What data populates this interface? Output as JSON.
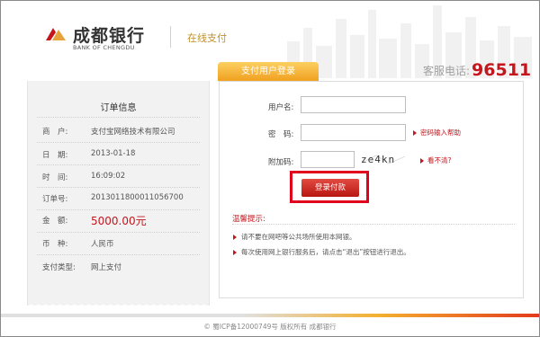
{
  "header": {
    "bank_name_cn": "成都银行",
    "bank_name_en": "BANK OF CHENGDU",
    "section": "在线支付",
    "hotline_label": "客服电话:",
    "hotline_number": "96511"
  },
  "login_tab": "支付用户登录",
  "order": {
    "title": "订单信息",
    "rows": [
      {
        "label": "商　户:",
        "value": "支付宝网络技术有限公司"
      },
      {
        "label": "日　期:",
        "value": "2013-01-18"
      },
      {
        "label": "时　间:",
        "value": "16:09:02"
      },
      {
        "label": "订单号:",
        "value": "2013011800011056700"
      },
      {
        "label": "金　额:",
        "value": "5000.00元"
      },
      {
        "label": "币　种:",
        "value": "人民币"
      },
      {
        "label": "支付类型:",
        "value": "网上支付"
      }
    ]
  },
  "form": {
    "username_label": "用户名:",
    "username_value": "",
    "password_label": "密　码:",
    "password_value": "",
    "password_help": "密码输入帮助",
    "captcha_label": "附加码:",
    "captcha_value": "",
    "captcha_text": "ze4kn",
    "captcha_refresh": "看不清?",
    "submit": "登录付款"
  },
  "tips": {
    "title": "温馨提示:",
    "items": [
      "请不要在网吧等公共场所使用本网银。",
      "每次使用网上银行服务后，请点击“退出”按钮进行退出。"
    ]
  },
  "footer": "© 蜀ICP备12000749号 版权所有 成都银行",
  "colors": {
    "brand_red": "#c4161c",
    "tab_gold": "#f0a020",
    "highlight": "#e0001b"
  }
}
